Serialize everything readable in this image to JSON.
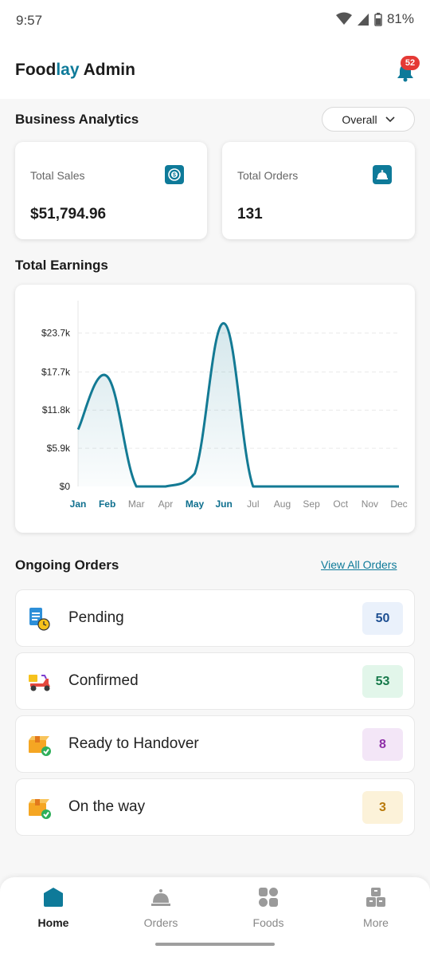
{
  "status_bar": {
    "time": "9:57",
    "battery": "81%"
  },
  "header": {
    "brand_part1": "Food",
    "brand_part2": "lay",
    "brand_part3": " Admin",
    "notification_count": "52"
  },
  "analytics": {
    "title": "Business Analytics",
    "filter": "Overall",
    "total_sales": {
      "label": "Total Sales",
      "value": "$51,794.96",
      "icon": "dollar-icon"
    },
    "total_orders": {
      "label": "Total Orders",
      "value": "131",
      "icon": "service-bell-icon"
    }
  },
  "earnings": {
    "title": "Total Earnings"
  },
  "chart_data": {
    "type": "area",
    "categories": [
      "Jan",
      "Feb",
      "Mar",
      "Apr",
      "May",
      "Jun",
      "Jul",
      "Aug",
      "Sep",
      "Oct",
      "Nov",
      "Dec"
    ],
    "highlighted_categories": [
      "Jan",
      "Feb",
      "May",
      "Jun"
    ],
    "values": [
      8800,
      17000,
      0,
      0,
      2000,
      25200,
      0,
      0,
      0,
      0,
      0,
      0
    ],
    "y_ticks": [
      "$0",
      "$5.9k",
      "$11.8k",
      "$17.7k",
      "$23.7k"
    ],
    "y_tick_values": [
      0,
      5900,
      11800,
      17700,
      23700
    ],
    "ylim": [
      0,
      25500
    ],
    "grid": true,
    "colors": {
      "line": "#137a94",
      "highlight_tick": "#0e6f8e",
      "tick": "#888888"
    }
  },
  "ongoing": {
    "title": "Ongoing Orders",
    "view_all": "View All Orders",
    "items": [
      {
        "label": "Pending",
        "count": "50",
        "icon": "pending-document-icon",
        "text_color": "#1d4f91",
        "bg_color": "#eaf1fb"
      },
      {
        "label": "Confirmed",
        "count": "53",
        "icon": "delivery-scooter-icon",
        "text_color": "#16794a",
        "bg_color": "#e2f6ea"
      },
      {
        "label": "Ready to Handover",
        "count": "8",
        "icon": "package-check-icon",
        "text_color": "#8e2fa8",
        "bg_color": "#f3e6f7"
      },
      {
        "label": "On the way",
        "count": "3",
        "icon": "package-check-icon",
        "text_color": "#b97a0a",
        "bg_color": "#fcf2d9"
      }
    ]
  },
  "nav": [
    {
      "label": "Home",
      "icon": "home-icon",
      "active": true
    },
    {
      "label": "Orders",
      "icon": "service-bell-icon",
      "active": false
    },
    {
      "label": "Foods",
      "icon": "grid-icon",
      "active": false
    },
    {
      "label": "More",
      "icon": "more-icon",
      "active": false
    }
  ],
  "colors": {
    "accent": "#0e7a99",
    "badge": "#e53935"
  }
}
